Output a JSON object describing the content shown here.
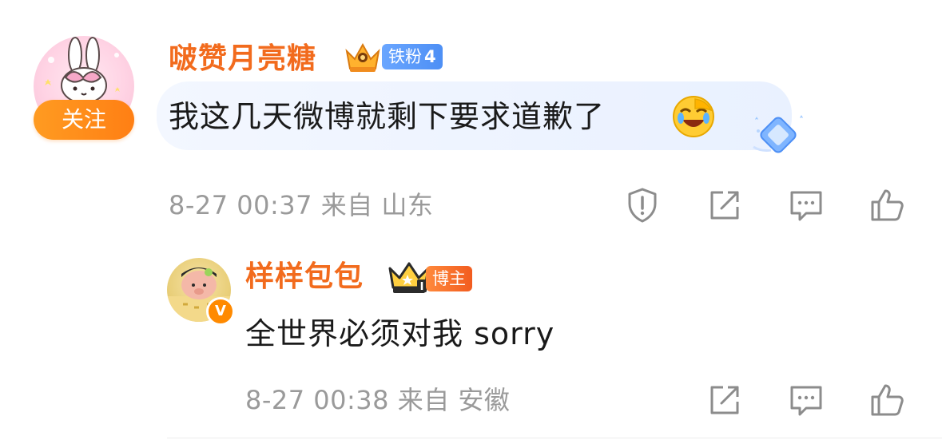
{
  "comments": [
    {
      "username": "啵赞月亮糖",
      "fan_badge": {
        "label": "铁粉",
        "level": "4"
      },
      "follow_label": "关注",
      "text": "我这几天微博就剩下要求道歉了",
      "time": "8-27 00:37",
      "from_label": "来自",
      "location": "山东",
      "icons": [
        "report-icon",
        "share-icon",
        "comment-icon",
        "like-icon"
      ]
    },
    {
      "username": "样样包包",
      "host_badge": "博主",
      "verified_mark": "V",
      "text": "全世界必须对我 sorry",
      "time": "8-27 00:38",
      "from_label": "来自",
      "location": "安徽",
      "icons": [
        "share-icon",
        "comment-icon",
        "like-icon"
      ]
    }
  ],
  "colors": {
    "username": "#f26b1d",
    "follow_button": "#ff8a1a",
    "fan_badge": "#5a9bf8",
    "host_badge": "#f5682a",
    "meta_text": "#9a9a9a",
    "icon_stroke": "#8c8c8c"
  }
}
